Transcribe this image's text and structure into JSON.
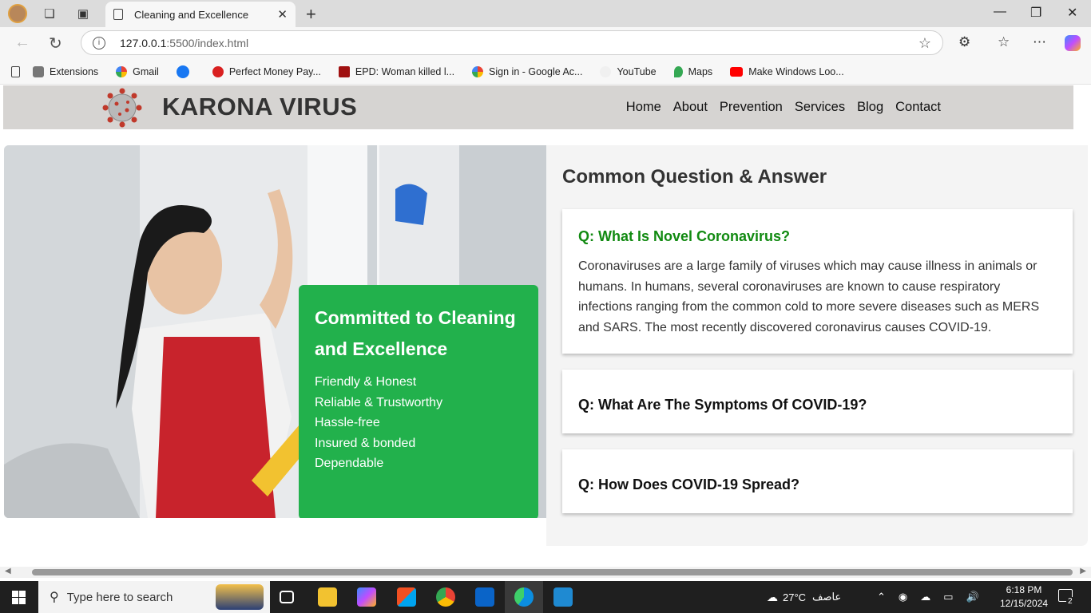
{
  "browser": {
    "tab_title": "Cleaning and Excellence",
    "url_host": "127.0.0.1",
    "url_rest": ":5500/index.html",
    "bookmarks": [
      "Extensions",
      "Gmail",
      "",
      "Perfect Money Pay...",
      "EPD: Woman killed l...",
      "Sign in - Google Ac...",
      "YouTube",
      "Maps",
      "Make Windows Loo..."
    ]
  },
  "site": {
    "brand": "KARONA VIRUS",
    "nav": [
      "Home",
      "About",
      "Prevention",
      "Services",
      "Blog",
      "Contact"
    ]
  },
  "promo": {
    "title": "Committed to Cleaning and Excellence",
    "items": [
      "Friendly & Honest",
      "Reliable & Trustworthy",
      "Hassle-free",
      "Insured & bonded",
      "Dependable"
    ]
  },
  "faq": {
    "heading": "Common Question & Answer",
    "items": [
      {
        "q": "Q: What Is Novel Coronavirus?",
        "a": "Coronaviruses are a large family of viruses which may cause illness in animals or humans. In humans, several coronaviruses are known to cause respiratory infections ranging from the common cold to more severe diseases such as MERS and SARS. The most recently discovered coronavirus causes COVID-19."
      },
      {
        "q": "Q: What Are The Symptoms Of COVID-19?",
        "a": ""
      },
      {
        "q": "Q: How Does COVID-19 Spread?",
        "a": ""
      }
    ]
  },
  "taskbar": {
    "search_placeholder": "Type here to search",
    "weather": "27°C",
    "weather_desc": "عاصف",
    "time": "6:18 PM",
    "date": "12/15/2024",
    "notifications": "2"
  },
  "colors": {
    "accent_green": "#22b14c",
    "question_green": "#118a11"
  }
}
